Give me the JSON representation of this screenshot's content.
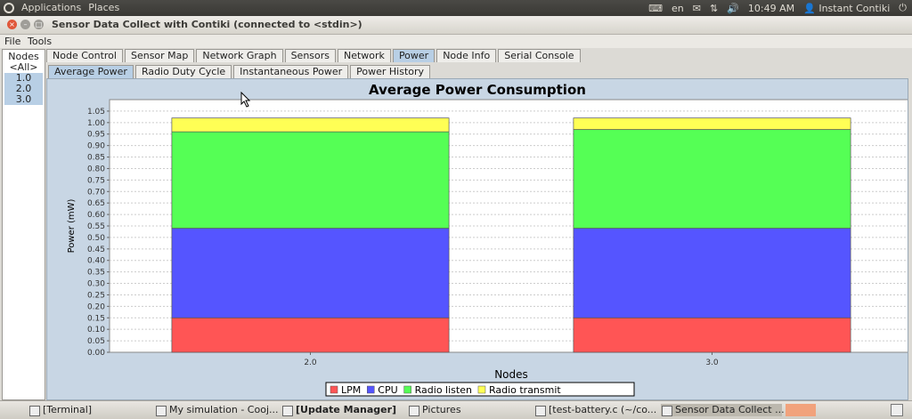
{
  "topbar": {
    "applications": "Applications",
    "places": "Places",
    "lang": "en",
    "time": "10:49 AM",
    "user": "Instant Contiki"
  },
  "window": {
    "title": "Sensor Data Collect with Contiki (connected to <stdin>)"
  },
  "menu": {
    "file": "File",
    "tools": "Tools"
  },
  "nodes": {
    "header": "Nodes",
    "items": [
      "<All>",
      "1.0",
      "2.0",
      "3.0"
    ]
  },
  "tabs": [
    "Node Control",
    "Sensor Map",
    "Network Graph",
    "Sensors",
    "Network",
    "Power",
    "Node Info",
    "Serial Console"
  ],
  "subtabs": [
    "Average Power",
    "Radio Duty Cycle",
    "Instantaneous Power",
    "Power History"
  ],
  "chart_data": {
    "type": "bar",
    "stacked": true,
    "title": "Average Power Consumption",
    "xlabel": "Nodes",
    "ylabel": "Power (mW)",
    "ylim": [
      0,
      1.1
    ],
    "yticks": [
      "0.00",
      "0.05",
      "0.10",
      "0.15",
      "0.20",
      "0.25",
      "0.30",
      "0.35",
      "0.40",
      "0.45",
      "0.50",
      "0.55",
      "0.60",
      "0.65",
      "0.70",
      "0.75",
      "0.80",
      "0.85",
      "0.90",
      "0.95",
      "1.00",
      "1.05"
    ],
    "categories": [
      "2.0",
      "3.0"
    ],
    "series": [
      {
        "name": "LPM",
        "color": "#ff5555",
        "values": [
          0.15,
          0.15
        ]
      },
      {
        "name": "CPU",
        "color": "#5555ff",
        "values": [
          0.39,
          0.39
        ]
      },
      {
        "name": "Radio listen",
        "color": "#55ff55",
        "values": [
          0.42,
          0.43
        ]
      },
      {
        "name": "Radio transmit",
        "color": "#ffff55",
        "values": [
          0.06,
          0.05
        ]
      }
    ],
    "grid": true,
    "legend": "bottom"
  },
  "taskbar": [
    "[Terminal]",
    "My simulation - Cooj...",
    "[Update Manager]",
    "Pictures",
    "[test-battery.c (~/co...",
    "Sensor Data Collect ..."
  ]
}
